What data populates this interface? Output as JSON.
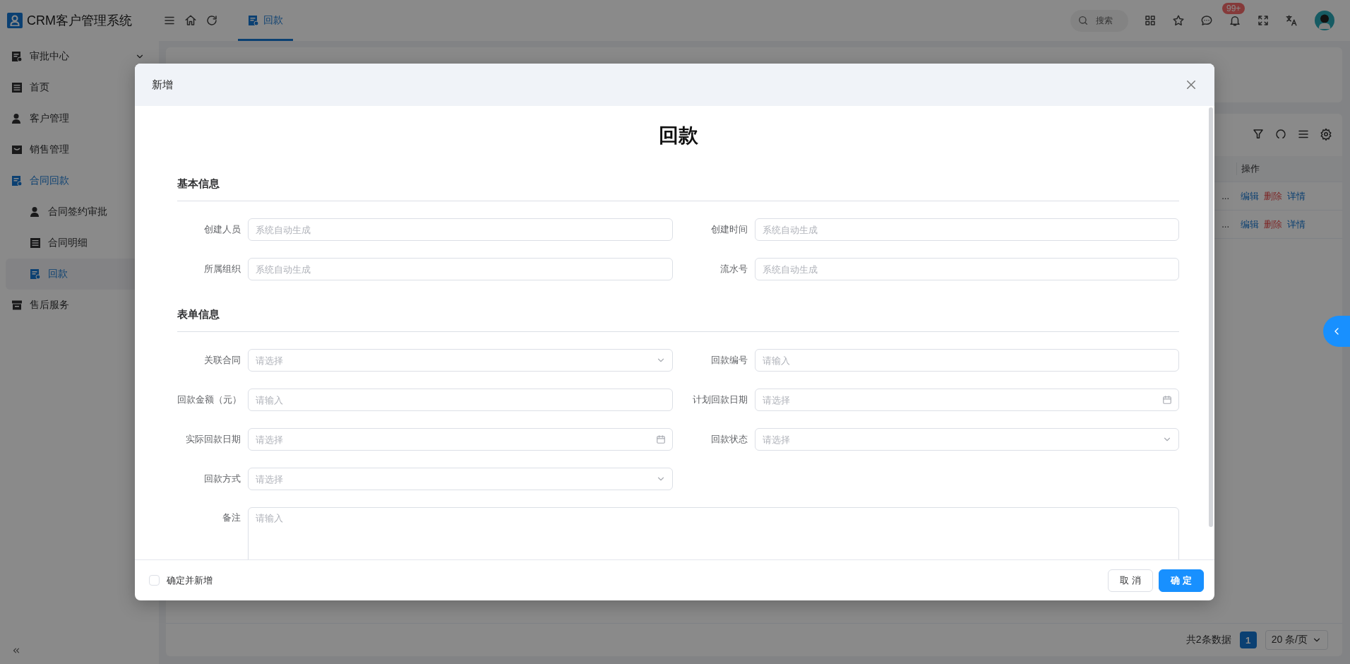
{
  "app": {
    "title": "CRM客户管理系统"
  },
  "tabs": [
    {
      "label": "回款",
      "selected": true
    }
  ],
  "search": {
    "placeholder": "搜索"
  },
  "notifications": {
    "badge": "99+"
  },
  "sidebar": {
    "items": [
      {
        "label": "审批中心",
        "selected": false,
        "expanded": false
      },
      {
        "label": "首页",
        "selected": false
      },
      {
        "label": "客户管理",
        "selected": false
      },
      {
        "label": "销售管理",
        "selected": false
      },
      {
        "label": "合同回款",
        "selected": true,
        "children": [
          {
            "label": "合同签约审批",
            "selected": false
          },
          {
            "label": "合同明细",
            "selected": false
          },
          {
            "label": "回款",
            "selected": true
          }
        ]
      },
      {
        "label": "售后服务",
        "selected": false
      }
    ]
  },
  "table": {
    "columns": [
      "操作"
    ],
    "rows": [
      {
        "column_1": "...",
        "actions": [
          {
            "label": "编辑",
            "kind": "link"
          },
          {
            "label": "删除",
            "kind": "danger"
          },
          {
            "label": "详情",
            "kind": "link"
          }
        ]
      },
      {
        "column_1": "...",
        "actions": [
          {
            "label": "编辑",
            "kind": "link"
          },
          {
            "label": "删除",
            "kind": "danger"
          },
          {
            "label": "详情",
            "kind": "link"
          }
        ]
      }
    ]
  },
  "pagination": {
    "total": "共2条数据",
    "pages": [
      {
        "label": "1",
        "selected": true
      }
    ],
    "page_size": "20 条/页"
  },
  "dialog": {
    "title": "新增",
    "heading": "回款",
    "sections": [
      {
        "title": "基本信息",
        "fields": [
          {
            "label": "创建人员",
            "kind": "text",
            "placeholder": "系统自动生成"
          },
          {
            "label": "创建时间",
            "kind": "text",
            "placeholder": "系统自动生成"
          },
          {
            "label": "所属组织",
            "kind": "text",
            "placeholder": "系统自动生成"
          },
          {
            "label": "流水号",
            "kind": "text",
            "placeholder": "系统自动生成"
          }
        ]
      },
      {
        "title": "表单信息",
        "fields": [
          {
            "label": "关联合同",
            "kind": "select",
            "placeholder": "请选择"
          },
          {
            "label": "回款编号",
            "kind": "text",
            "placeholder": "请输入"
          },
          {
            "label": "回款金额（元）",
            "kind": "text",
            "placeholder": "请输入"
          },
          {
            "label": "计划回款日期",
            "kind": "date",
            "placeholder": "请选择"
          },
          {
            "label": "实际回款日期",
            "kind": "date",
            "placeholder": "请选择"
          },
          {
            "label": "回款状态",
            "kind": "select",
            "placeholder": "请选择"
          },
          {
            "label": "回款方式",
            "kind": "select",
            "placeholder": "请选择"
          },
          {
            "label": "备注",
            "kind": "textarea",
            "placeholder": "请输入"
          }
        ]
      }
    ],
    "footer": {
      "continue": {
        "label": "确定并新增",
        "checked": false
      },
      "buttons": [
        {
          "label": "取 消",
          "kind": "default"
        },
        {
          "label": "确 定",
          "kind": "primary"
        }
      ]
    }
  }
}
